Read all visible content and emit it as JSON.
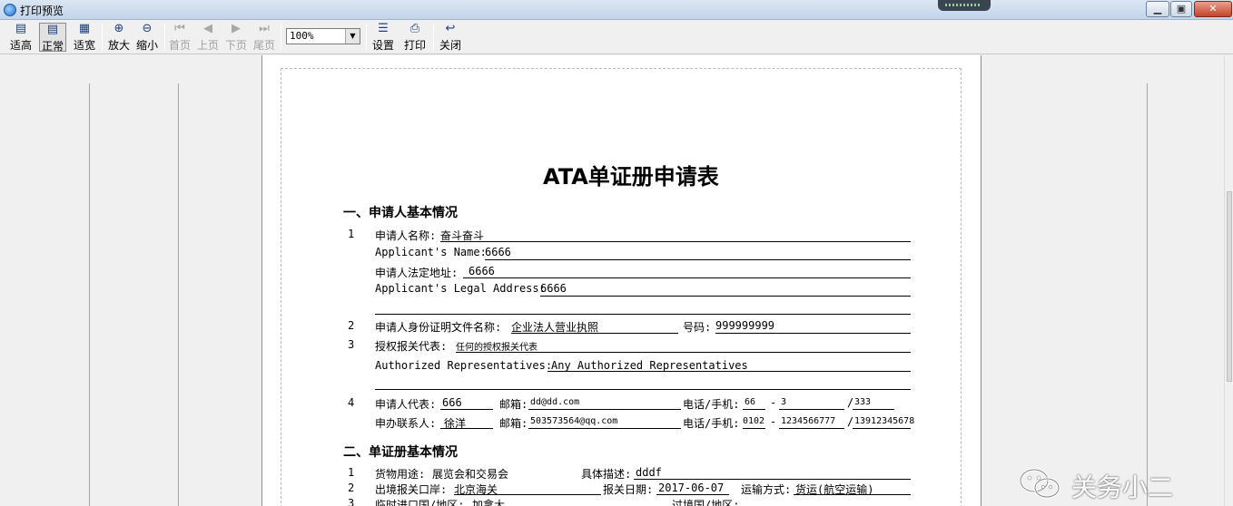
{
  "window": {
    "title": "打印预览"
  },
  "toolbar": {
    "buttons": [
      {
        "label": "适高"
      },
      {
        "label": "正常"
      },
      {
        "label": "适宽"
      },
      {
        "label": "放大"
      },
      {
        "label": "缩小"
      },
      {
        "label": "首页"
      },
      {
        "label": "上页"
      },
      {
        "label": "下页"
      },
      {
        "label": "尾页"
      },
      {
        "label": "设置"
      },
      {
        "label": "打印"
      },
      {
        "label": "关闭"
      }
    ],
    "zoom_value": "100%"
  },
  "document": {
    "title": "ATA单证册申请表",
    "section1": {
      "heading": "一、申请人基本情况"
    },
    "section2": {
      "heading": "二、单证册基本情况"
    },
    "rows": {
      "n1": "1",
      "applicant_name_label": "申请人名称:",
      "applicant_name_value": "奋斗奋斗",
      "applicant_name_en_label": "Applicant's Name:",
      "applicant_name_en_value": "6666",
      "legal_address_label": "申请人法定地址:",
      "legal_address_value": "6666",
      "legal_address_en_label": "Applicant's Legal Address:",
      "legal_address_en_value": "6666",
      "n2": "2",
      "id_doc_label": "申请人身份证明文件名称:",
      "id_doc_value": "企业法人营业执照",
      "id_no_label": "号码:",
      "id_no_value": "999999999",
      "n3": "3",
      "auth_rep_label": "授权报关代表:",
      "auth_rep_value": "任何的授权报关代表",
      "auth_rep_en_label": "Authorized Representatives:",
      "auth_rep_en_value": "Any Authorized Representatives",
      "n4": "4",
      "rep_label": "申请人代表:",
      "rep_value": "666",
      "rep_email_label": "邮箱:",
      "rep_email_value": "dd@dd.com",
      "rep_phone_label": "电话/手机:",
      "rep_phone_a": "66",
      "rep_phone_dash": "-",
      "rep_phone_b": "3",
      "rep_phone_slash": "/",
      "rep_phone_c": "333",
      "contact_label": "申办联系人:",
      "contact_value": "徐洋",
      "contact_email_label": "邮箱:",
      "contact_email_value": "503573564@qq.com",
      "contact_phone_label": "电话/手机:",
      "contact_phone_a": "0102",
      "contact_phone_dash": "-",
      "contact_phone_b": "1234566777",
      "contact_phone_slash": "/",
      "contact_phone_c": "13912345678",
      "s2n1": "1",
      "usage_label": "货物用途:",
      "usage_value": "展览会和交易会",
      "desc_label": "具体描述:",
      "desc_value": "dddf",
      "s2n2": "2",
      "exit_port_label": "出境报关口岸:",
      "exit_port_value": "北京海关",
      "decl_date_label": "报关日期:",
      "decl_date_value": "2017-06-07",
      "transport_label": "运输方式:",
      "transport_value": "货运(航空运输)",
      "s2n3": "3",
      "temp_entry_label": "临时进口国/地区:",
      "temp_entry_value": "加拿大",
      "transit_label": "过境国/地区:"
    }
  },
  "watermark": {
    "text": "关务小二"
  }
}
